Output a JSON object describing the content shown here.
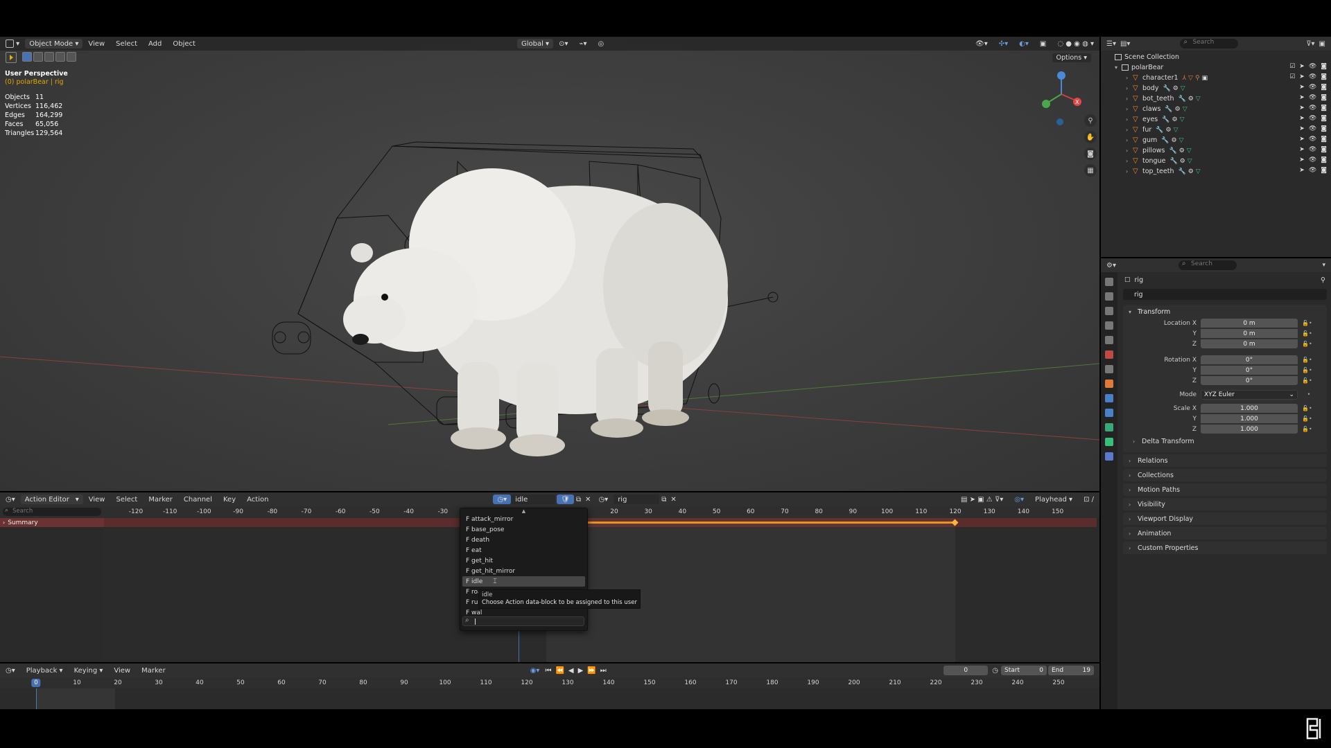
{
  "viewport": {
    "header": {
      "mode": "Object Mode",
      "menus": [
        "View",
        "Select",
        "Add",
        "Object"
      ],
      "orientation": "Global",
      "options": "Options"
    },
    "info": {
      "title": "User Perspective",
      "subtitle": "(0) polarBear | rig"
    },
    "stats": [
      {
        "label": "Objects",
        "value": "11"
      },
      {
        "label": "Vertices",
        "value": "116,462"
      },
      {
        "label": "Edges",
        "value": "164,299"
      },
      {
        "label": "Faces",
        "value": "65,056"
      },
      {
        "label": "Triangles",
        "value": "129,564"
      }
    ]
  },
  "outliner": {
    "search_placeholder": "Search",
    "root": "Scene Collection",
    "collection": "polarBear",
    "items": [
      {
        "name": "character1",
        "mods": [
          "armature",
          "constraint",
          "pose",
          "data"
        ]
      },
      {
        "name": "body",
        "mods": [
          "wrench",
          "modifier",
          "mesh"
        ]
      },
      {
        "name": "bot_teeth",
        "mods": [
          "wrench",
          "modifier",
          "mesh"
        ]
      },
      {
        "name": "claws",
        "mods": [
          "wrench",
          "modifier",
          "mesh"
        ]
      },
      {
        "name": "eyes",
        "mods": [
          "wrench",
          "modifier",
          "mesh"
        ]
      },
      {
        "name": "fur",
        "mods": [
          "wrench",
          "modifier",
          "mesh"
        ]
      },
      {
        "name": "gum",
        "mods": [
          "wrench",
          "modifier",
          "mesh"
        ]
      },
      {
        "name": "pillows",
        "mods": [
          "wrench",
          "modifier",
          "mesh"
        ]
      },
      {
        "name": "tongue",
        "mods": [
          "wrench",
          "modifier",
          "mesh"
        ]
      },
      {
        "name": "top_teeth",
        "mods": [
          "wrench",
          "modifier",
          "mesh"
        ]
      }
    ]
  },
  "properties": {
    "search_placeholder": "Search",
    "object_name": "rig",
    "name_field": "rig",
    "transform_title": "Transform",
    "location": {
      "label": "Location X",
      "x": "0 m",
      "y": "0 m",
      "z": "0 m"
    },
    "rotation": {
      "label": "Rotation X",
      "x": "0°",
      "y": "0°",
      "z": "0°"
    },
    "mode": {
      "label": "Mode",
      "value": "XYZ Euler"
    },
    "scale": {
      "label": "Scale X",
      "x": "1.000",
      "y": "1.000",
      "z": "1.000"
    },
    "axis_y": "Y",
    "axis_z": "Z",
    "delta": "Delta Transform",
    "sections": [
      "Relations",
      "Collections",
      "Motion Paths",
      "Visibility",
      "Viewport Display",
      "Animation",
      "Custom Properties"
    ]
  },
  "action_editor": {
    "editor_type": "Action Editor",
    "menus": [
      "View",
      "Select",
      "Marker",
      "Channel",
      "Key",
      "Action"
    ],
    "action_name": "idle",
    "object_name": "rig",
    "playhead_label": "Playhead",
    "search_placeholder": "Search",
    "summary": "Summary",
    "ruler": [
      "-120",
      "-110",
      "-100",
      "-90",
      "-80",
      "-70",
      "-60",
      "-50",
      "-40",
      "-30",
      "20",
      "30",
      "40",
      "50",
      "60",
      "70",
      "80",
      "90",
      "100",
      "110",
      "120",
      "130",
      "140",
      "150"
    ],
    "keyframe_range": {
      "start": 0,
      "end": 120
    }
  },
  "dropdown": {
    "items": [
      {
        "label": "F attack_mirror",
        "hover": false
      },
      {
        "label": "F base_pose",
        "hover": false
      },
      {
        "label": "F death",
        "hover": false
      },
      {
        "label": "F eat",
        "hover": false
      },
      {
        "label": "F get_hit",
        "hover": false
      },
      {
        "label": "F get_hit_mirror",
        "hover": false
      },
      {
        "label": "F idle",
        "hover": true
      },
      {
        "label": "F roa",
        "hover": false
      },
      {
        "label": "F run",
        "hover": false
      },
      {
        "label": "F wal",
        "hover": false
      }
    ],
    "tooltip_title": "idle",
    "tooltip_text": "Choose Action data-block to be assigned to this user"
  },
  "timeline": {
    "menus": [
      "Playback",
      "Keying",
      "View",
      "Marker"
    ],
    "current_frame": "0",
    "start_label": "Start",
    "start": "0",
    "end_label": "End",
    "end": "19",
    "ruler": [
      "10",
      "20",
      "30",
      "40",
      "50",
      "60",
      "70",
      "80",
      "90",
      "100",
      "110",
      "120",
      "130",
      "140",
      "150",
      "160",
      "170",
      "180",
      "190",
      "200",
      "210",
      "220",
      "230",
      "240",
      "250"
    ]
  },
  "colors": {
    "accent_blue": "#4772b3",
    "object_orange": "#f08a2a",
    "summary_red": "#6a3232",
    "keyframe": "#e8961a"
  }
}
